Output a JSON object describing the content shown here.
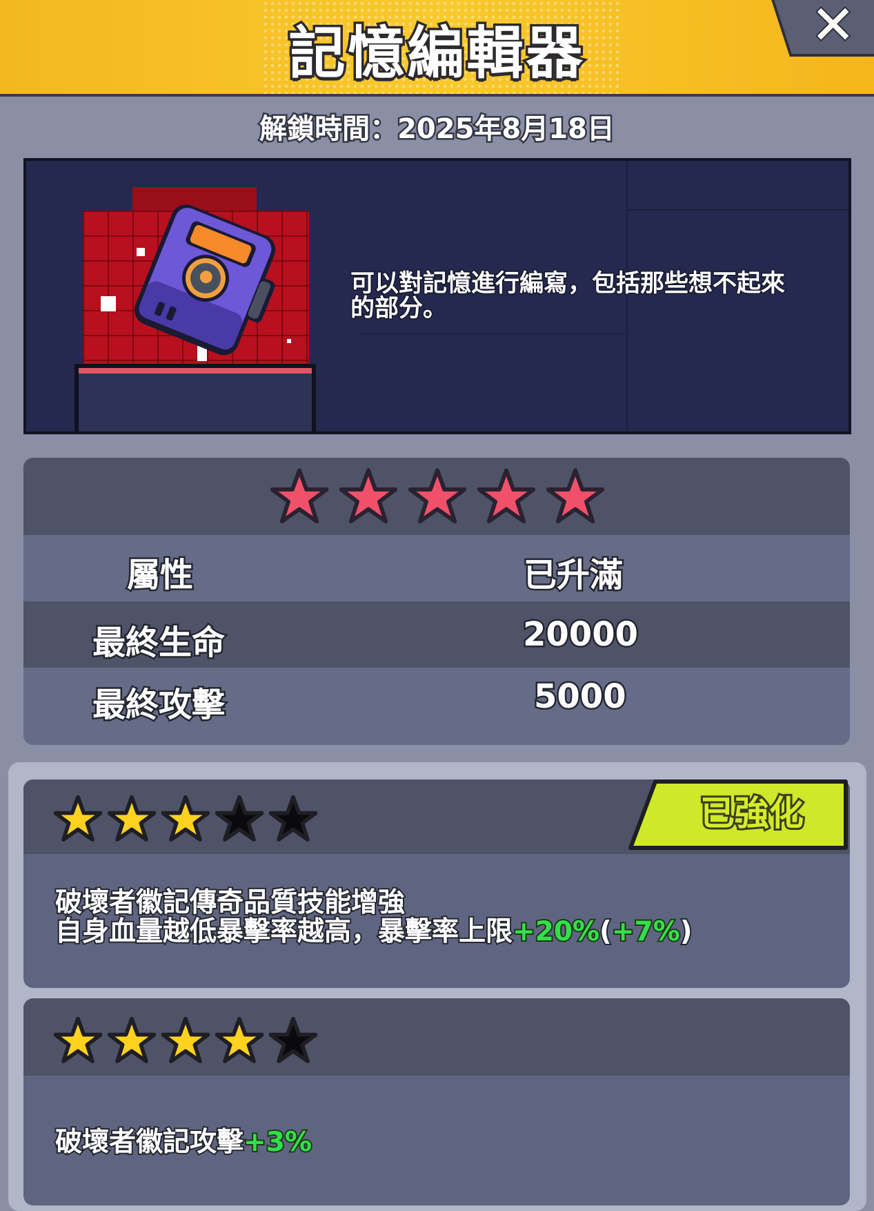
{
  "header": {
    "title": "記憶編輯器",
    "close_label": "✕"
  },
  "unlock_text": "解鎖時間：2025年8月18日",
  "item": {
    "description_line1": "可以對記憶進行編寫，包括那些想不起來",
    "description_line2": "的部分。",
    "icon": "memory-editor-device-icon"
  },
  "stats": {
    "star_count": 5,
    "header": {
      "label": "屬性",
      "value": "已升滿"
    },
    "rows": [
      {
        "label": "最終生命",
        "value": "20000"
      },
      {
        "label": "最終攻擊",
        "value": "5000"
      }
    ]
  },
  "bonuses": [
    {
      "stars_filled": 3,
      "stars_total": 5,
      "badge": "已強化",
      "line1": "破壞者徽記傳奇品質技能增強",
      "line2_text": "自身血量越低暴擊率越高，暴擊率上限",
      "line2_green": "+20%",
      "line2_paren_open": "(",
      "line2_green2": "+7%",
      "line2_paren_close": ")"
    },
    {
      "stars_filled": 4,
      "stars_total": 5,
      "line1_text": "破壞者徽記攻擊",
      "line1_green": "+3%"
    }
  ],
  "colors": {
    "header_gold": "#f9c92c",
    "star_pink": "#f0506a",
    "star_gold": "#ffd21f",
    "badge_lime": "#d6ec2c",
    "bonus_green": "#33e04a"
  }
}
